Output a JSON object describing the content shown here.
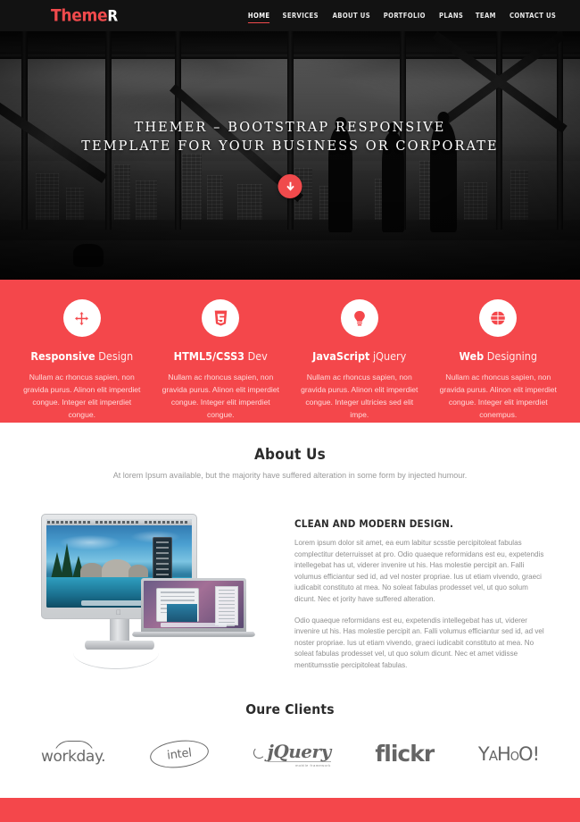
{
  "header": {
    "logo_primary": "Theme",
    "logo_secondary": "R",
    "nav": [
      {
        "label": "HOME",
        "active": true
      },
      {
        "label": "SERVICES",
        "active": false
      },
      {
        "label": "ABOUT US",
        "active": false
      },
      {
        "label": "PORTFOLIO",
        "active": false
      },
      {
        "label": "PLANS",
        "active": false
      },
      {
        "label": "TEAM",
        "active": false
      },
      {
        "label": "CONTACT US",
        "active": false
      }
    ]
  },
  "hero": {
    "line1": "THEMER – BOOTSTRAP RESPONSIVE",
    "line2": "TEMPLATE FOR YOUR BUSINESS OR CORPORATE",
    "scroll_icon": "arrow-down-circle-icon"
  },
  "features": {
    "background_color": "#F4474B",
    "items": [
      {
        "icon": "arrows-move-icon",
        "title_bold": "Responsive",
        "title_light": "Design",
        "desc": "Nullam ac rhoncus sapien, non gravida purus. Alinon elit imperdiet congue. Integer elit imperdiet congue."
      },
      {
        "icon": "css3-icon",
        "title_bold": "HTML5/CSS3",
        "title_light": "Dev",
        "desc": "Nullam ac rhoncus sapien, non gravida purus. Alinon elit imperdiet congue. Integer elit imperdiet congue."
      },
      {
        "icon": "lightbulb-icon",
        "title_bold": "JavaScript",
        "title_light": "jQuery",
        "desc": "Nullam ac rhoncus sapien, non gravida purus. Alinon elit imperdiet congue. Integer ultricies sed elit impe."
      },
      {
        "icon": "globe-icon",
        "title_bold": "Web",
        "title_light": "Designing",
        "desc": "Nullam ac rhoncus sapien, non gravida purus. Alinon elit imperdiet congue. Integer elit imperdiet conempus."
      }
    ]
  },
  "about": {
    "title": "About Us",
    "subtitle": "At lorem Ipsum available, but the majority have suffered alteration in some form by injected humour.",
    "image_alt": "apple-cinema-display-and-macbook-image",
    "heading": "CLEAN AND MODERN DESIGN.",
    "paragraph1": "Lorem ipsum dolor sit amet, ea eum labitur scsstie percipitoleat fabulas complectitur deterruisset at pro. Odio quaeque reformidans est eu, expetendis intellegebat has ut, viderer invenire ut his. Has molestie percipit an. Falli volumus efficiantur sed id, ad vel noster propriae. Ius ut etiam vivendo, graeci iudicabit constituto at mea. No soleat fabulas prodesset vel, ut quo solum dicunt. Nec et jority have suffered alteration.",
    "paragraph2": "Odio quaeque reformidans est eu, expetendis intellegebat has ut, viderer invenire ut his. Has molestie percipit an. Falli volumus efficiantur sed id, ad vel noster propriae. Ius ut etiam vivendo, graeci iudicabit constituto at mea. No soleat fabulas prodesset vel, ut quo solum dicunt. Nec et amet vidisse mentitumsstie percipitoleat fabulas."
  },
  "clients": {
    "title": "Oure Clients",
    "logos": [
      {
        "name": "workday-logo",
        "text": "workday."
      },
      {
        "name": "intel-logo",
        "text": "intel"
      },
      {
        "name": "jquery-logo",
        "text": "jQuery",
        "sub": "mobile framework"
      },
      {
        "name": "flickr-logo",
        "text": "flickr"
      },
      {
        "name": "yahoo-logo",
        "text": "YAHOO!"
      }
    ]
  },
  "footer": {
    "background_color": "#F4474B"
  }
}
